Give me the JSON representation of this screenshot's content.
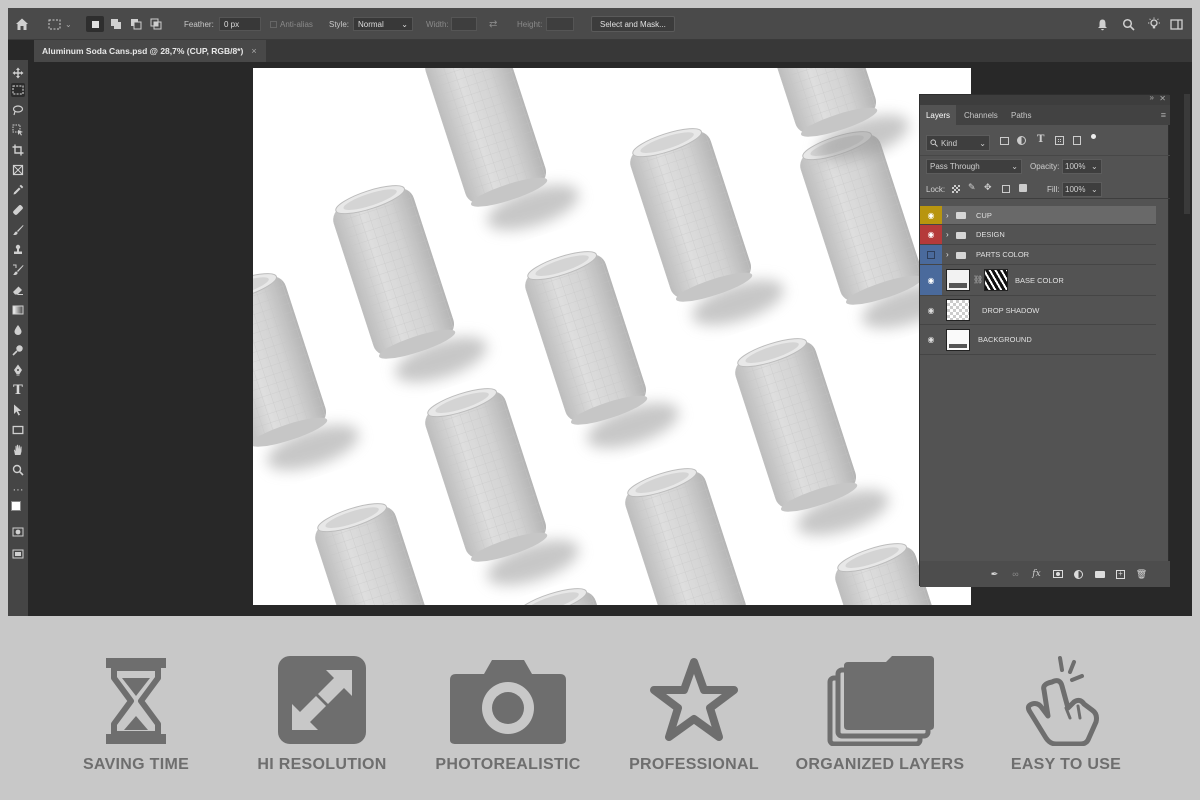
{
  "options_bar": {
    "feather_label": "Feather:",
    "feather_value": "0 px",
    "antialias_label": "Anti-alias",
    "style_label": "Style:",
    "style_value": "Normal",
    "width_label": "Width:",
    "height_label": "Height:",
    "select_mask_label": "Select and Mask..."
  },
  "document_tab": {
    "title": "Aluminum Soda Cans.psd @ 28,7% (CUP, RGB/8*)",
    "close_glyph": "×"
  },
  "layers_panel": {
    "tabs": [
      "Layers",
      "Channels",
      "Paths"
    ],
    "active_tab": "Layers",
    "filter_kind": "Kind",
    "blend_mode": "Pass Through",
    "opacity_label": "Opacity:",
    "opacity_value": "100%",
    "lock_label": "Lock:",
    "fill_label": "Fill:",
    "fill_value": "100%",
    "layers": [
      {
        "name": "CUP",
        "type": "group",
        "visible": true,
        "color": "#b8950f",
        "selected": true
      },
      {
        "name": "DESIGN",
        "type": "group",
        "visible": true,
        "color": "#b53a3a",
        "selected": false
      },
      {
        "name": "PARTS COLOR",
        "type": "group",
        "visible": false,
        "color": "#4a6a9c",
        "selected": false
      },
      {
        "name": "BASE COLOR",
        "type": "layer-mask",
        "visible": true,
        "color": "#4a6a9c",
        "selected": false
      },
      {
        "name": "DROP SHADOW",
        "type": "layer",
        "visible": true,
        "color": "",
        "selected": false
      },
      {
        "name": "BACKGROUND",
        "type": "layer",
        "visible": true,
        "color": "",
        "selected": false
      }
    ]
  },
  "features": [
    {
      "label": "SAVING TIME",
      "icon": "hourglass-icon"
    },
    {
      "label": "HI RESOLUTION",
      "icon": "expand-arrows-icon"
    },
    {
      "label": "PHOTOREALISTIC",
      "icon": "camera-icon"
    },
    {
      "label": "PROFESSIONAL",
      "icon": "star-icon"
    },
    {
      "label": "ORGANIZED LAYERS",
      "icon": "folders-icon"
    },
    {
      "label": "EASY TO USE",
      "icon": "hand-tap-icon"
    }
  ],
  "colors": {
    "app_bg": "#282828",
    "panel_bg": "#535353",
    "feature_bg": "#c8c8c8",
    "feature_icon": "#6e6e6e",
    "can_fill": "#d8d8d8"
  }
}
